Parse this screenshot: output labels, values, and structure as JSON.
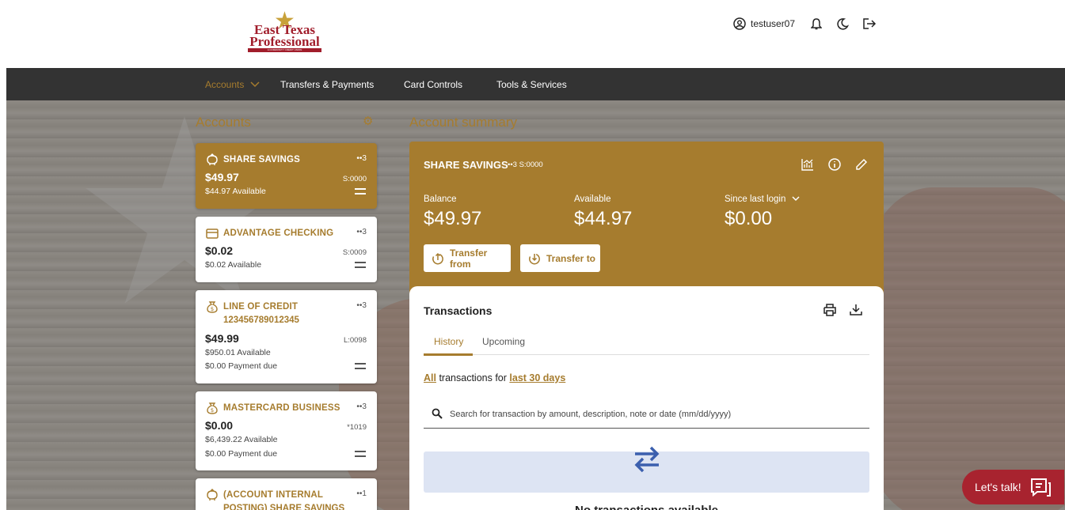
{
  "header": {
    "logo": {
      "line1": "East Texas",
      "line2": "Professional",
      "tagline": "A COMMUNITY CREDIT UNION"
    },
    "username": "testuser07"
  },
  "nav": [
    {
      "label": "Accounts"
    },
    {
      "label": "Transfers & Payments"
    },
    {
      "label": "Card Controls"
    },
    {
      "label": "Tools & Services"
    }
  ],
  "sidebar": {
    "title": "Accounts",
    "cards": [
      {
        "name": "SHARE SAVINGS",
        "dots": "••3",
        "balance": "$49.97",
        "code": "S:0000",
        "available": "$44.97 Available"
      },
      {
        "name": "ADVANTAGE CHECKING",
        "dots": "••3",
        "balance": "$0.02",
        "code": "S:0009",
        "available": "$0.02 Available"
      },
      {
        "name": "LINE OF CREDIT",
        "number": "123456789012345",
        "dots": "••3",
        "balance": "$49.99",
        "code": "L:0098",
        "available": "$950.01 Available",
        "payment": "$0.00 Payment due"
      },
      {
        "name": "MASTERCARD BUSINESS",
        "dots": "••3",
        "balance": "$0.00",
        "code": "*1019",
        "available": "$6,439.22 Available",
        "payment": "$0.00 Payment due"
      },
      {
        "name": "(ACCOUNT INTERNAL",
        "name2": "POSTING) SHARE SAVINGS",
        "dots": "••1"
      }
    ]
  },
  "summary": {
    "title": "Account summary",
    "account_name": "SHARE SAVINGS",
    "mask": "••3  S:0000",
    "balance_label": "Balance",
    "balance": "$49.97",
    "available_label": "Available",
    "available": "$44.97",
    "since_label": "Since last login",
    "since": "$0.00",
    "transfer_from": "Transfer from",
    "transfer_to": "Transfer to"
  },
  "transactions": {
    "title": "Transactions",
    "tabs": [
      "History",
      "Upcoming"
    ],
    "filter_all": "All",
    "filter_mid": " transactions for ",
    "filter_range": "last 30 days",
    "search_placeholder": "Search for transaction by amount, description, note or date (mm/dd/yyyy)",
    "empty": "No transactions available"
  },
  "chat": {
    "label": "Let's talk!"
  },
  "colors": {
    "brand": "#a67c2e",
    "nav": "#333333",
    "chat": "#a8232f",
    "accent_blue": "#3b5fae"
  }
}
